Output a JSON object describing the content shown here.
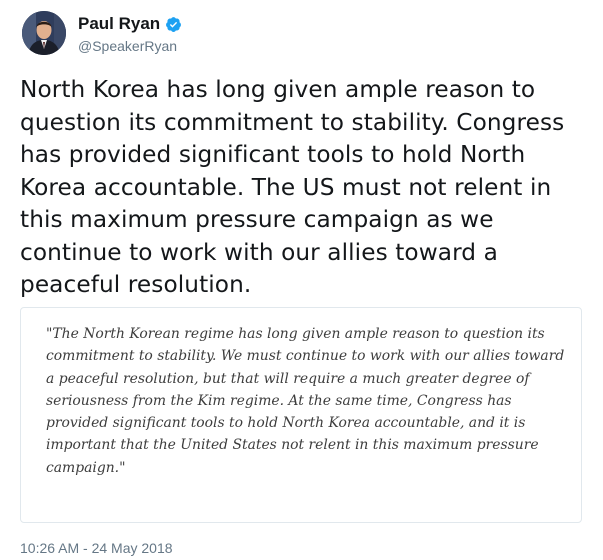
{
  "author": {
    "name": "Paul Ryan",
    "handle": "@SpeakerRyan",
    "verified": true,
    "avatar_icon": "profile-photo"
  },
  "tweet": {
    "text": "North Korea has long given ample reason to question its commitment to stability. Congress has provided significant tools to hold North Korea accountable. The US must not relent in this maximum pressure campaign as we continue to work with our allies toward a peaceful resolution."
  },
  "quote_card": {
    "text": "\"The North Korean regime has long given ample reason to question its commitment to stability. We must continue to work with our allies toward a peaceful resolution, but that will require a much greater degree of seriousness from the Kim regime. At the same time, Congress has provided significant tools to hold North Korea accountable, and it is important that the United States not relent in this maximum pressure campaign.\""
  },
  "timestamp": "10:26 AM - 24 May 2018",
  "colors": {
    "verified_badge": "#1da1f2",
    "secondary_text": "#657786",
    "primary_text": "#14171a",
    "card_border": "#e1e8ed"
  }
}
